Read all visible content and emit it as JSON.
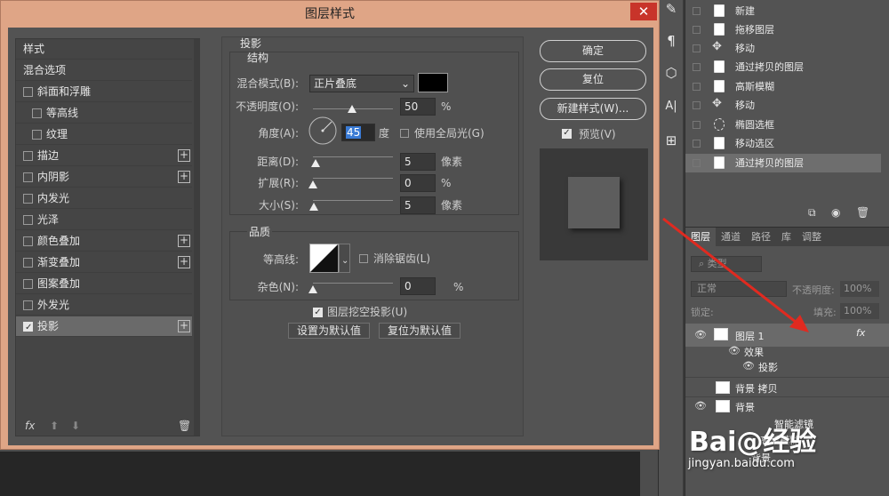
{
  "dialog": {
    "title": "图层样式",
    "close": "✕"
  },
  "style_list": {
    "items": [
      {
        "label": "样式",
        "check": false,
        "header": true
      },
      {
        "label": "混合选项",
        "check": false,
        "header": true
      },
      {
        "label": "斜面和浮雕",
        "check": true,
        "checked": false
      },
      {
        "label": "等高线",
        "check": true,
        "checked": false,
        "indent": true
      },
      {
        "label": "纹理",
        "check": true,
        "checked": false,
        "indent": true
      },
      {
        "label": "描边",
        "check": true,
        "checked": false,
        "plus": true
      },
      {
        "label": "内阴影",
        "check": true,
        "checked": false,
        "plus": true
      },
      {
        "label": "内发光",
        "check": true,
        "checked": false
      },
      {
        "label": "光泽",
        "check": true,
        "checked": false
      },
      {
        "label": "颜色叠加",
        "check": true,
        "checked": false,
        "plus": true
      },
      {
        "label": "渐变叠加",
        "check": true,
        "checked": false,
        "plus": true
      },
      {
        "label": "图案叠加",
        "check": true,
        "checked": false
      },
      {
        "label": "外发光",
        "check": true,
        "checked": false
      },
      {
        "label": "投影",
        "check": true,
        "checked": true,
        "plus": true,
        "selected": true
      }
    ],
    "footer": {
      "fx": "fx",
      "up": "⬆",
      "down": "⬇",
      "trash": "🗑"
    }
  },
  "drop_shadow": {
    "section": "投影",
    "structure": "结构",
    "blend_mode_label": "混合模式(B):",
    "blend_mode": "正片叠底",
    "blend_color": "#000000",
    "opacity_label": "不透明度(O):",
    "opacity": "50",
    "opacity_unit": "%",
    "angle_label": "角度(A):",
    "angle": "45",
    "angle_unit": "度",
    "global_light": "使用全局光(G)",
    "distance_label": "距离(D):",
    "distance": "5",
    "distance_unit": "像素",
    "spread_label": "扩展(R):",
    "spread": "0",
    "spread_unit": "%",
    "size_label": "大小(S):",
    "size": "5",
    "size_unit": "像素",
    "quality": "品质",
    "contour_label": "等高线:",
    "antialias": "消除锯齿(L)",
    "noise_label": "杂色(N):",
    "noise": "0",
    "noise_unit": "%",
    "knockout": "图层挖空投影(U)",
    "make_default": "设置为默认值",
    "reset_default": "复位为默认值"
  },
  "buttons": {
    "ok": "确定",
    "reset": "复位",
    "new_style": "新建样式(W)...",
    "preview": "预览(V)"
  },
  "history": {
    "items": [
      "新建",
      "拖移图层",
      "移动",
      "通过拷贝的图层",
      "高斯模糊",
      "移动",
      "椭圆选框",
      "移动选区",
      "通过拷贝的图层"
    ]
  },
  "layers_panel": {
    "tabs": [
      "图层",
      "通道",
      "路径",
      "库",
      "调整"
    ],
    "kind": "类型",
    "blend": "正常",
    "opacity_label": "不透明度:",
    "opacity": "100%",
    "lock_label": "锁定:",
    "fill_label": "填充:",
    "fill": "100%",
    "layers": {
      "layer1": "图层 1",
      "fx": "fx",
      "effects": "效果",
      "shadow": "投影",
      "bg_copy": "背景 拷贝",
      "bg1": "背景",
      "smart_filter": "智能滤镜",
      "gauss": "高斯模糊",
      "bg2": "背景"
    }
  },
  "watermark": {
    "logo": "Bai@经验",
    "url": "jingyan.baidu.com"
  }
}
